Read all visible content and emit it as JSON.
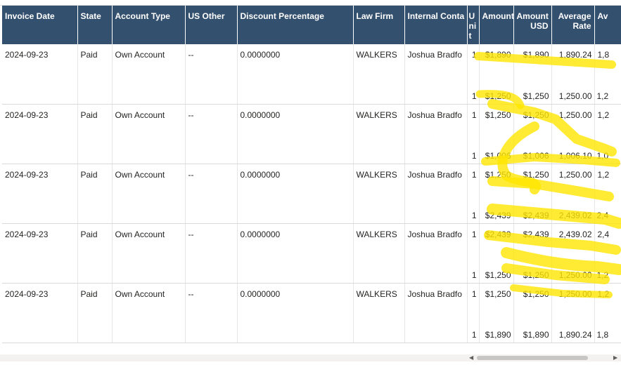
{
  "columns": {
    "invoice_date": "Invoice Date",
    "state": "State",
    "account_type": "Account Type",
    "us_other": "US Other",
    "discount_percentage": "Discount Percentage",
    "law_firm": "Law Firm",
    "internal_contact": "Internal Conta",
    "unit": "Unit",
    "amount": "Amount",
    "amount_usd": "Amount USD",
    "average_rate": "Average Rate",
    "av": "Av"
  },
  "rows": [
    {
      "invoice_date": "2024-09-23",
      "state": "Paid",
      "account_type": "Own Account",
      "us_other": "--",
      "discount": "0.0000000",
      "law_firm": "WALKERS",
      "internal_contact": "Joshua Bradfo",
      "unit_top": "1",
      "amount_top": "$1,890",
      "amount_usd_top": "$1,890",
      "average_rate_top": "1,890.24",
      "av_top": "1,8",
      "unit_bot": "1",
      "amount_bot": "$1,250",
      "amount_usd_bot": "$1,250",
      "average_rate_bot": "1,250.00",
      "av_bot": "1,2"
    },
    {
      "invoice_date": "2024-09-23",
      "state": "Paid",
      "account_type": "Own Account",
      "us_other": "--",
      "discount": "0.0000000",
      "law_firm": "WALKERS",
      "internal_contact": "Joshua Bradfo",
      "unit_top": "1",
      "amount_top": "$1,250",
      "amount_usd_top": "$1,250",
      "average_rate_top": "1,250.00",
      "av_top": "1,2",
      "unit_bot": "1",
      "amount_bot": "$1,006",
      "amount_usd_bot": "$1,006",
      "average_rate_bot": "1,006.10",
      "av_bot": "1,0"
    },
    {
      "invoice_date": "2024-09-23",
      "state": "Paid",
      "account_type": "Own Account",
      "us_other": "--",
      "discount": "0.0000000",
      "law_firm": "WALKERS",
      "internal_contact": "Joshua Bradfo",
      "unit_top": "1",
      "amount_top": "$1,250",
      "amount_usd_top": "$1,250",
      "average_rate_top": "1,250.00",
      "av_top": "1,2",
      "unit_bot": "1",
      "amount_bot": "$2,439",
      "amount_usd_bot": "$2,439",
      "average_rate_bot": "2,439.02",
      "av_bot": "2,4"
    },
    {
      "invoice_date": "2024-09-23",
      "state": "Paid",
      "account_type": "Own Account",
      "us_other": "--",
      "discount": "0.0000000",
      "law_firm": "WALKERS",
      "internal_contact": "Joshua Bradfo",
      "unit_top": "1",
      "amount_top": "$2,439",
      "amount_usd_top": "$2,439",
      "average_rate_top": "2,439.02",
      "av_top": "2,4",
      "unit_bot": "1",
      "amount_bot": "$1,250",
      "amount_usd_bot": "$1,250",
      "average_rate_bot": "1,250.00",
      "av_bot": "1,2"
    },
    {
      "invoice_date": "2024-09-23",
      "state": "Paid",
      "account_type": "Own Account",
      "us_other": "--",
      "discount": "0.0000000",
      "law_firm": "WALKERS",
      "internal_contact": "Joshua Bradfo",
      "unit_top": "1",
      "amount_top": "$1,250",
      "amount_usd_top": "$1,250",
      "average_rate_top": "1,250.00",
      "av_top": "1,2",
      "unit_bot": "1",
      "amount_bot": "$1,890",
      "amount_usd_bot": "$1,890",
      "average_rate_bot": "1,890.24",
      "av_bot": "1,8"
    }
  ],
  "colors": {
    "header_bg": "#34506f",
    "header_text": "#ffffff",
    "highlight": "#ffe600"
  },
  "icons": {
    "scroll_left": "scroll-left-icon",
    "scroll_right": "scroll-right-icon"
  }
}
